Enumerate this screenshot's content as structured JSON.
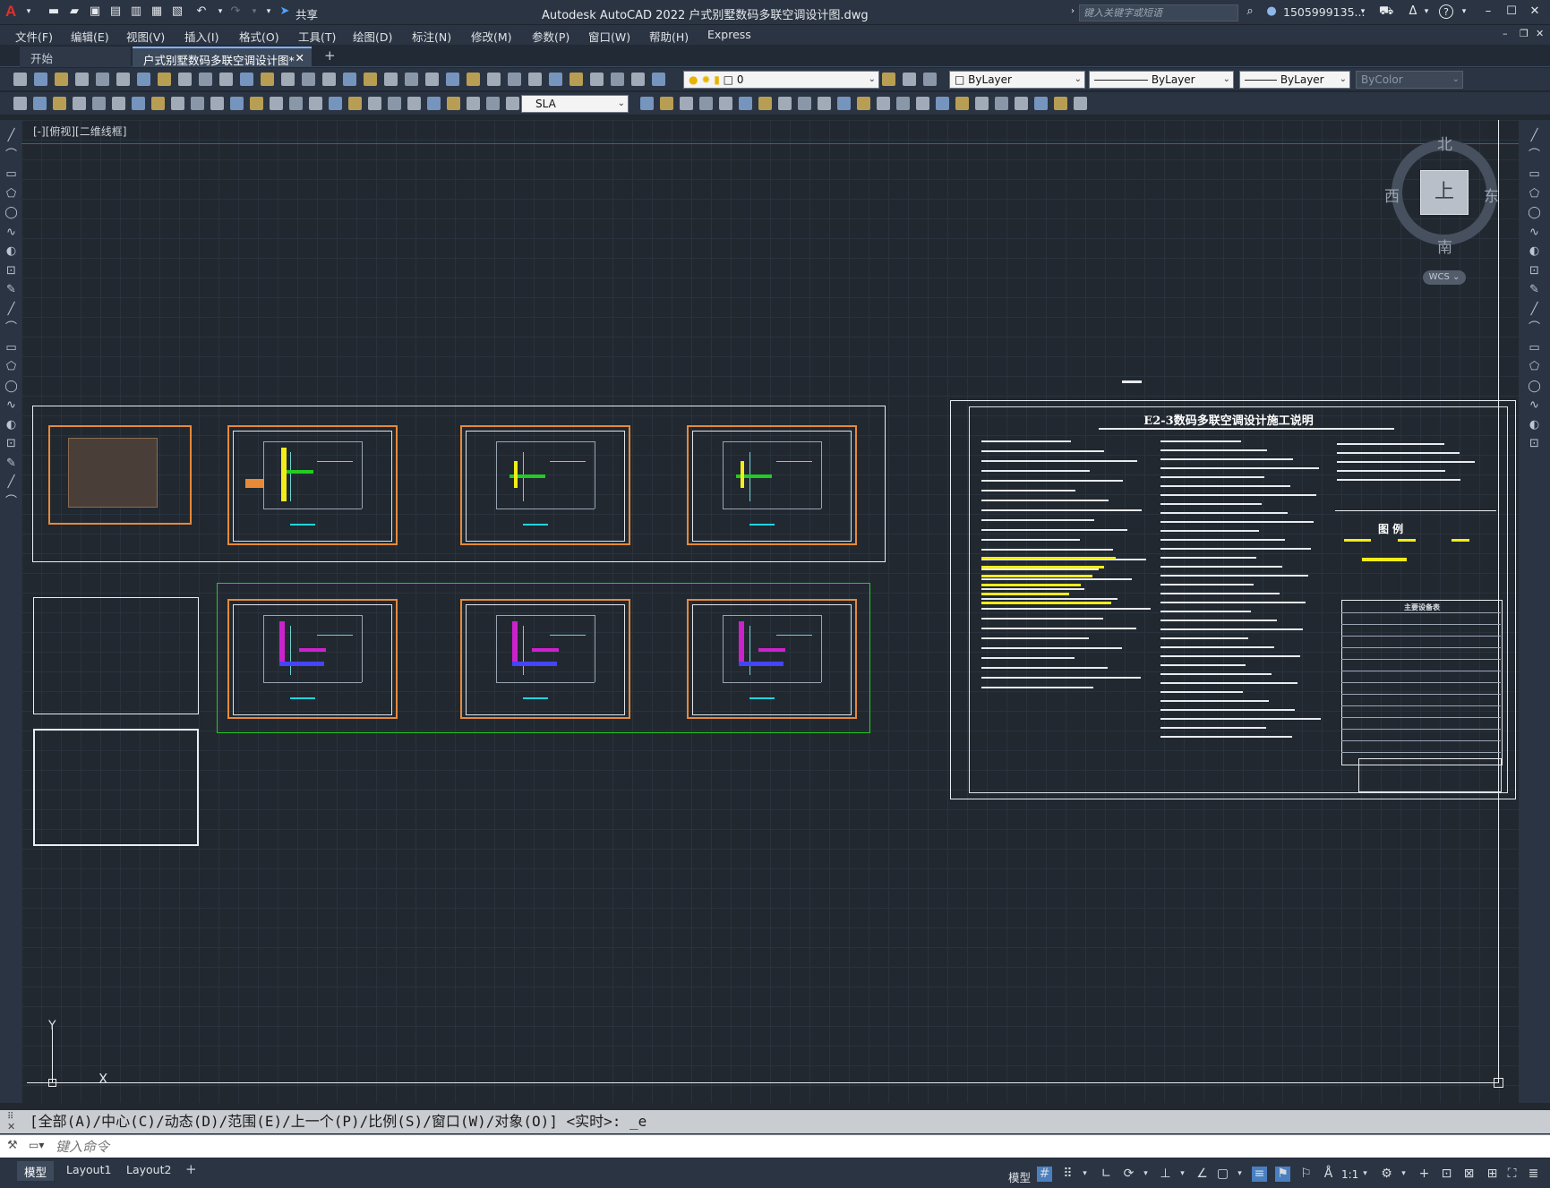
{
  "app": {
    "title": "Autodesk AutoCAD 2022    户式别墅数码多联空调设计图.dwg",
    "share_label": "共享",
    "search_placeholder": "键入关键字或短语",
    "user": "1505999135...",
    "help": "?"
  },
  "menu": [
    "文件(F)",
    "编辑(E)",
    "视图(V)",
    "插入(I)",
    "格式(O)",
    "工具(T)",
    "绘图(D)",
    "标注(N)",
    "修改(M)",
    "参数(P)",
    "窗口(W)",
    "帮助(H)",
    "Express"
  ],
  "file_tabs": [
    {
      "label": "开始",
      "active": false
    },
    {
      "label": "户式别墅数码多联空调设计图*",
      "active": true
    }
  ],
  "toolbar": {
    "layer_value": "0",
    "color_value": "ByLayer",
    "linetype_value": "ByLayer",
    "lineweight_value": "ByLayer",
    "plotstyle_value": "ByColor",
    "dimstyle_value": "SLA"
  },
  "viewport": {
    "label": "[-][俯视][二维线框]",
    "viewcube": {
      "north": "北",
      "south": "南",
      "east": "东",
      "west": "西",
      "face": "上",
      "wcs": "WCS"
    },
    "ucs": {
      "x": "X",
      "y": "Y"
    }
  },
  "drawing": {
    "spec_title": "E2-3数码多联空调设计施工说明",
    "legend_title": "图    例",
    "equipment_table_title": "主要设备表"
  },
  "command": {
    "history": "[全部(A)/中心(C)/动态(D)/范围(E)/上一个(P)/比例(S)/窗口(W)/对象(O)] <实时>: _e",
    "placeholder": "键入命令"
  },
  "layout_tabs": [
    {
      "label": "模型",
      "active": true
    },
    {
      "label": "Layout1",
      "active": false
    },
    {
      "label": "Layout2",
      "active": false
    }
  ],
  "status": {
    "model_label": "模型",
    "scale": "1:1"
  },
  "colors": {
    "accent_red": "#e0302a",
    "background": "#212830",
    "panel": "#2b3442",
    "sheet_orange": "#e68a3a",
    "highlight_green": "#22cc22",
    "legend_yellow": "#f2ec1a"
  }
}
